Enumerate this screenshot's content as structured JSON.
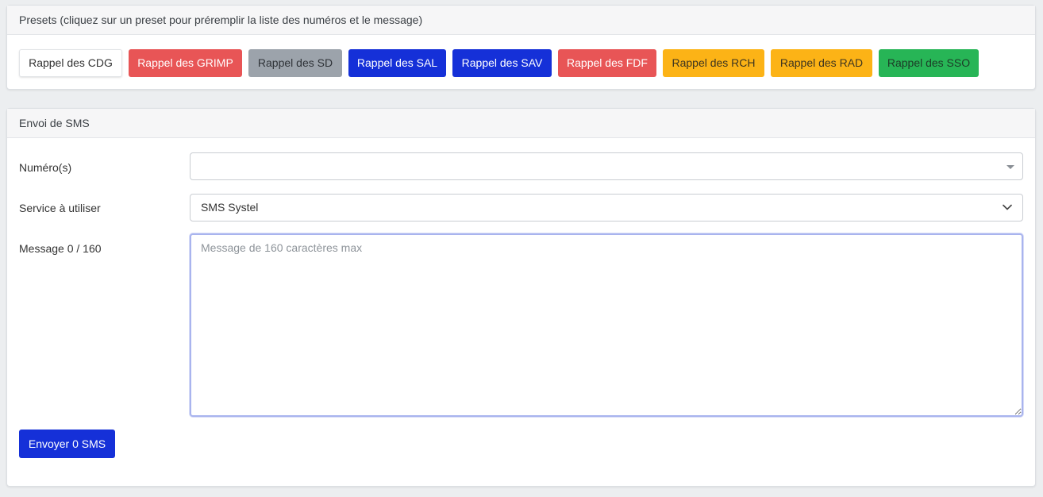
{
  "presets": {
    "header": "Presets (cliquez sur un preset pour préremplir la liste des numéros et le message)",
    "buttons": [
      {
        "label": "Rappel des CDG",
        "color": "white"
      },
      {
        "label": "Rappel des GRIMP",
        "color": "#e85556"
      },
      {
        "label": "Rappel des SD",
        "color": "#9ca3ab"
      },
      {
        "label": "Rappel des SAL",
        "color": "#1530d8"
      },
      {
        "label": "Rappel des SAV",
        "color": "#1530d8"
      },
      {
        "label": "Rappel des FDF",
        "color": "#e85556"
      },
      {
        "label": "Rappel des RCH",
        "color": "#fcb316"
      },
      {
        "label": "Rappel des RAD",
        "color": "#fcb316"
      },
      {
        "label": "Rappel des SSO",
        "color": "#27b556"
      }
    ]
  },
  "sms": {
    "header": "Envoi de SMS",
    "numeros_label": "Numéro(s)",
    "numeros_value": "",
    "service_label": "Service à utiliser",
    "service_value": "SMS Systel",
    "message_label": "Message 0 / 160",
    "message_value": "",
    "message_placeholder": "Message de 160 caractères max",
    "send_label": "Envoyer 0 SMS"
  },
  "icons": {
    "numeros_dropdown": "caret-down-icon",
    "service_dropdown": "chevron-down-icon"
  }
}
